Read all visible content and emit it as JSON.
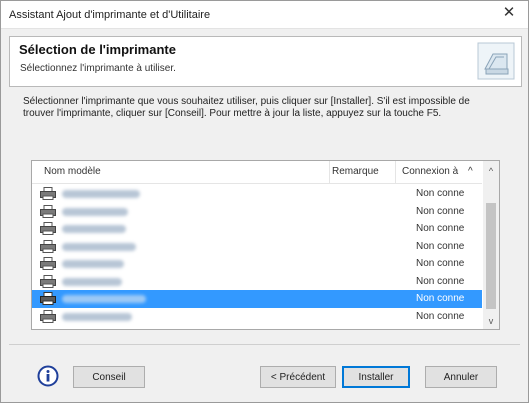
{
  "window": {
    "title": "Assistant Ajout d'imprimante et d'Utilitaire",
    "close_glyph": "✕"
  },
  "header": {
    "title": "Sélection de l'imprimante",
    "subtitle": "Sélectionnez l'imprimante à utiliser.",
    "icon": "printer-wizard-icon"
  },
  "instruction": "Sélectionner l'imprimante que vous souhaitez utiliser, puis cliquer sur [Installer]. S'il est impossible de trouver l'imprimante, cliquer sur [Conseil]. Pour mettre à jour la liste, appuyez sur la touche F5.",
  "list": {
    "columns": [
      "Nom modèle",
      "Remarque",
      "Connexion à"
    ],
    "sort_glyph": "^",
    "rows": [
      {
        "connection": "Non conne",
        "selected": false
      },
      {
        "connection": "Non conne",
        "selected": false
      },
      {
        "connection": "Non conne",
        "selected": false
      },
      {
        "connection": "Non conne",
        "selected": false
      },
      {
        "connection": "Non conne",
        "selected": false
      },
      {
        "connection": "Non conne",
        "selected": false
      },
      {
        "connection": "Non conne",
        "selected": true
      },
      {
        "connection": "Non conne",
        "selected": false
      }
    ],
    "scroll_up_glyph": "^",
    "scroll_down_glyph": "v",
    "selection_color": "#3399ff"
  },
  "footer": {
    "info_icon": "info-icon",
    "conseil_label": "Conseil",
    "precedent_label": "< Précédent",
    "installer_label": "Installer",
    "annuler_label": "Annuler"
  }
}
